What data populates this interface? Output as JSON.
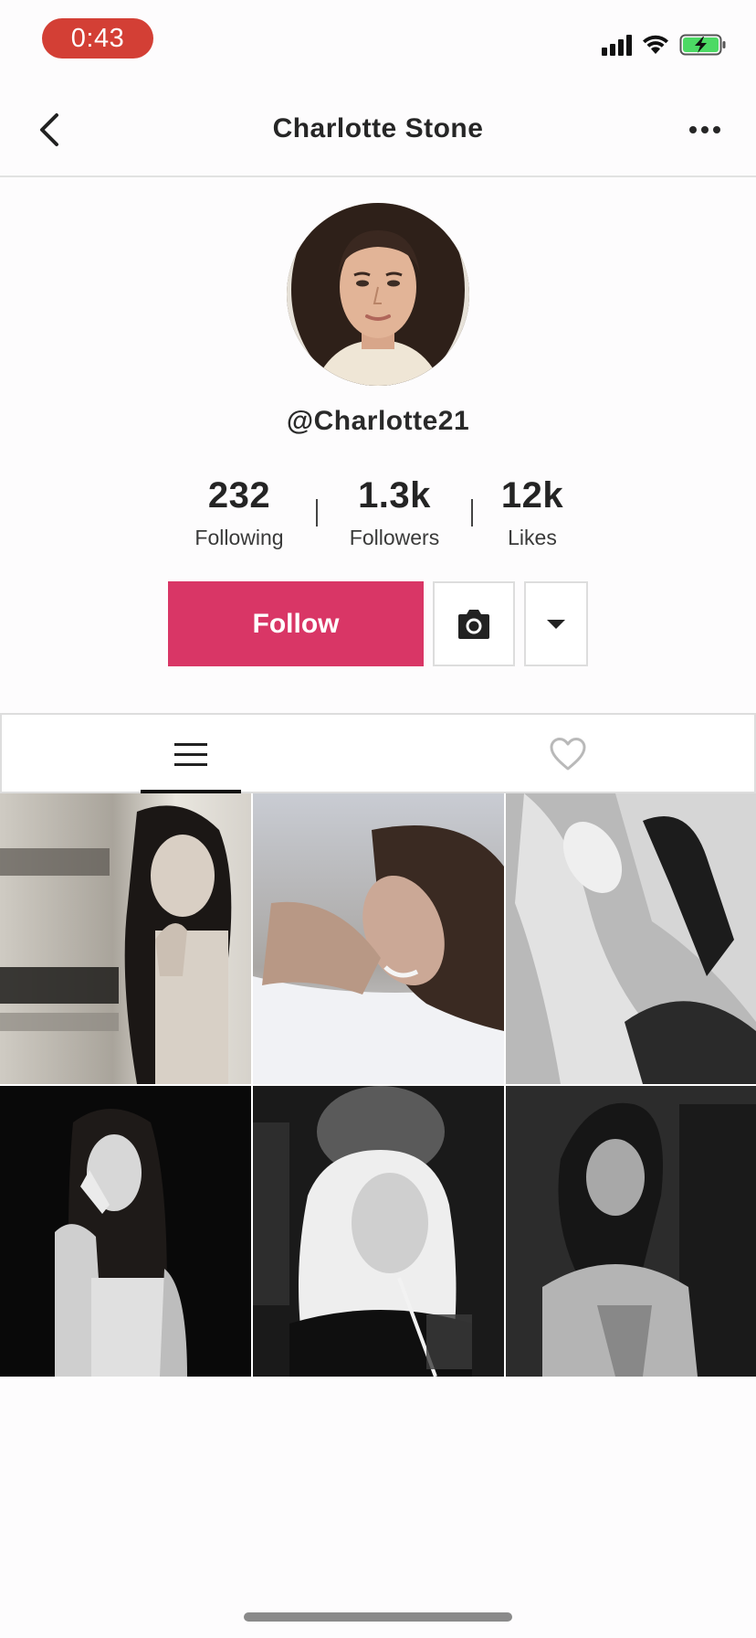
{
  "status_bar": {
    "time": "0:43",
    "icons": [
      "cellular-signal-icon",
      "wifi-icon",
      "battery-charging-icon"
    ]
  },
  "header": {
    "title": "Charlotte Stone",
    "back_icon": "chevron-left-icon",
    "more_icon": "more-horizontal-icon"
  },
  "profile": {
    "username": "@Charlotte21",
    "stats": [
      {
        "value": "232",
        "label": "Following"
      },
      {
        "value": "1.3k",
        "label": "Followers"
      },
      {
        "value": "12k",
        "label": "Likes"
      }
    ]
  },
  "actions": {
    "follow_label": "Follow",
    "camera_icon": "camera-icon",
    "dropdown_icon": "caret-down-icon"
  },
  "tabs": [
    {
      "icon": "list-icon",
      "active": true
    },
    {
      "icon": "heart-icon",
      "active": false
    }
  ],
  "colors": {
    "time_pill": "#d33f35",
    "follow_button": "#d93666",
    "battery_fill": "#4cd964"
  }
}
